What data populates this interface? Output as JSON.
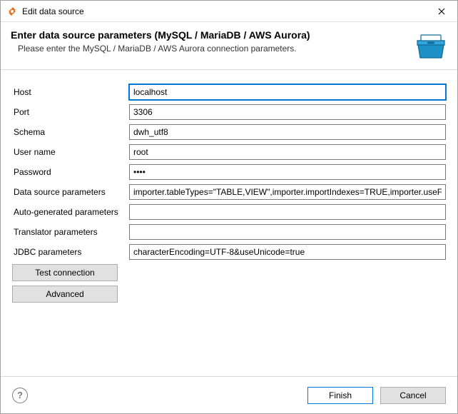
{
  "window": {
    "title": "Edit data source"
  },
  "banner": {
    "heading": "Enter data source parameters (MySQL / MariaDB / AWS Aurora)",
    "sub": "Please enter the MySQL / MariaDB / AWS Aurora connection parameters."
  },
  "fields": {
    "host": {
      "label": "Host",
      "value": "localhost"
    },
    "port": {
      "label": "Port",
      "value": "3306"
    },
    "schema": {
      "label": "Schema",
      "value": "dwh_utf8"
    },
    "user": {
      "label": "User name",
      "value": "root"
    },
    "password": {
      "label": "Password",
      "value": "••••"
    },
    "dsparams": {
      "label": "Data source parameters",
      "value": "importer.tableTypes=\"TABLE,VIEW\",importer.importIndexes=TRUE,importer.useFullSc"
    },
    "autogen": {
      "label": "Auto-generated parameters",
      "value": ""
    },
    "translator": {
      "label": "Translator parameters",
      "value": ""
    },
    "jdbc": {
      "label": "JDBC parameters",
      "value": "characterEncoding=UTF-8&useUnicode=true"
    }
  },
  "buttons": {
    "test": "Test connection",
    "advanced": "Advanced",
    "finish": "Finish",
    "cancel": "Cancel"
  },
  "help": "?"
}
